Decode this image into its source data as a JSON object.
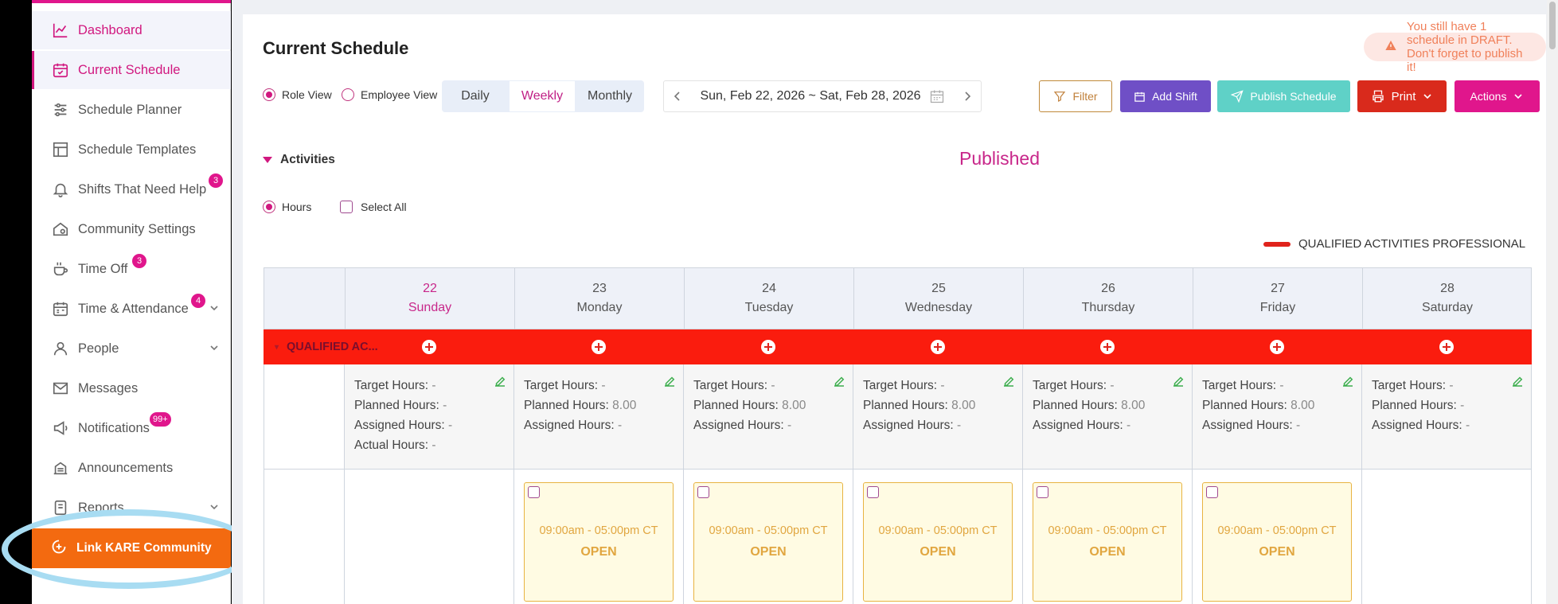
{
  "sidebar": {
    "items": [
      {
        "label": "Dashboard",
        "icon": "chart-line-icon"
      },
      {
        "label": "Current Schedule",
        "icon": "calendar-check-icon"
      },
      {
        "label": "Schedule Planner",
        "icon": "sliders-icon"
      },
      {
        "label": "Schedule Templates",
        "icon": "layout-template-icon"
      },
      {
        "label": "Shifts That Need Help",
        "icon": "bell-icon",
        "badge": "3"
      },
      {
        "label": "Community Settings",
        "icon": "home-gear-icon"
      },
      {
        "label": "Time Off",
        "icon": "coffee-cup-icon",
        "badge": "3"
      },
      {
        "label": "Time & Attendance",
        "icon": "calendar-clock-icon",
        "badge": "4"
      },
      {
        "label": "People",
        "icon": "person-icon"
      },
      {
        "label": "Messages",
        "icon": "envelope-icon"
      },
      {
        "label": "Notifications",
        "icon": "megaphone-icon",
        "badge": "99+"
      },
      {
        "label": "Announcements",
        "icon": "announcements-icon"
      },
      {
        "label": "Reports",
        "icon": "reports-icon"
      }
    ],
    "link_kare": "Link KARE Community"
  },
  "header": {
    "title": "Current Schedule",
    "draft_banner": "You still have 1 schedule in DRAFT. Don't forget to publish it!"
  },
  "view": {
    "role_view": "Role View",
    "employee_view": "Employee View",
    "periods": [
      "Daily",
      "Weekly",
      "Monthly"
    ],
    "date_range": "Sun, Feb 22, 2026 ~ Sat, Feb 28, 2026"
  },
  "toolbar": {
    "filter": "Filter",
    "add_shift": "Add Shift",
    "publish": "Publish Schedule",
    "print": "Print",
    "actions": "Actions"
  },
  "activities": {
    "label": "Activities",
    "status": "Published",
    "hours": "Hours",
    "select_all": "Select All",
    "legend": "QUALIFIED ACTIVITIES PROFESSIONAL"
  },
  "calendar": {
    "days": [
      {
        "num": "22",
        "name": "Sunday"
      },
      {
        "num": "23",
        "name": "Monday"
      },
      {
        "num": "24",
        "name": "Tuesday"
      },
      {
        "num": "25",
        "name": "Wednesday"
      },
      {
        "num": "26",
        "name": "Thursday"
      },
      {
        "num": "27",
        "name": "Friday"
      },
      {
        "num": "28",
        "name": "Saturday"
      }
    ],
    "role_label": "QUALIFIED AC...",
    "stat_labels": {
      "target": "Target Hours:",
      "planned": "Planned Hours:",
      "assigned": "Assigned Hours:",
      "actual": "Actual Hours:"
    },
    "stats": [
      {
        "target": "-",
        "planned": "-",
        "assigned": "-",
        "actual": "-"
      },
      {
        "target": "-",
        "planned": "8.00",
        "assigned": "-"
      },
      {
        "target": "-",
        "planned": "8.00",
        "assigned": "-"
      },
      {
        "target": "-",
        "planned": "8.00",
        "assigned": "-"
      },
      {
        "target": "-",
        "planned": "8.00",
        "assigned": "-"
      },
      {
        "target": "-",
        "planned": "8.00",
        "assigned": "-"
      },
      {
        "target": "-",
        "planned": "-",
        "assigned": "-"
      }
    ],
    "shift": {
      "time": "09:00am - 05:00pm CT",
      "status": "OPEN"
    }
  },
  "colors": {
    "brand": "#e0168c",
    "role_bar": "#fa1c0e",
    "cta_orange": "#f36a10",
    "shift_open": "#e1a640"
  }
}
